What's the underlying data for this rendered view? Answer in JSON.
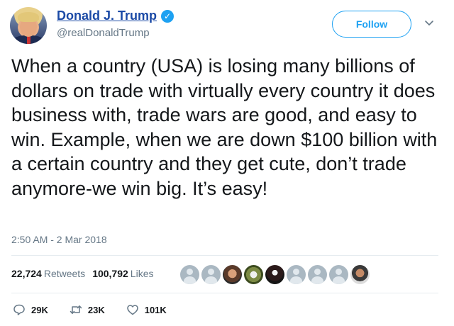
{
  "header": {
    "display_name": "Donald J. Trump",
    "handle": "@realDonaldTrump",
    "follow_label": "Follow"
  },
  "tweet": {
    "text": "When a country (USA) is losing many billions of dollars on trade with virtually every country it does business with, trade wars are good, and easy to win. Example, when we are down $100 billion with a certain country and they get cute, don’t trade anymore-we win big. It’s easy!",
    "timestamp": "2:50 AM - 2 Mar 2018"
  },
  "stats": {
    "retweets_count": "22,724",
    "retweets_label": "Retweets",
    "likes_count": "100,792",
    "likes_label": "Likes"
  },
  "likers": [
    "default",
    "default",
    "photo1",
    "photo2",
    "photo3",
    "default",
    "default",
    "default",
    "photo4"
  ],
  "actions": {
    "replies": "29K",
    "retweets": "23K",
    "likes": "101K"
  },
  "colors": {
    "link": "#1b4aa6",
    "accent": "#1da1f2",
    "muted": "#657786"
  },
  "icons": [
    "verified-badge-icon",
    "chevron-down-icon",
    "reply-icon",
    "retweet-icon",
    "like-icon"
  ]
}
